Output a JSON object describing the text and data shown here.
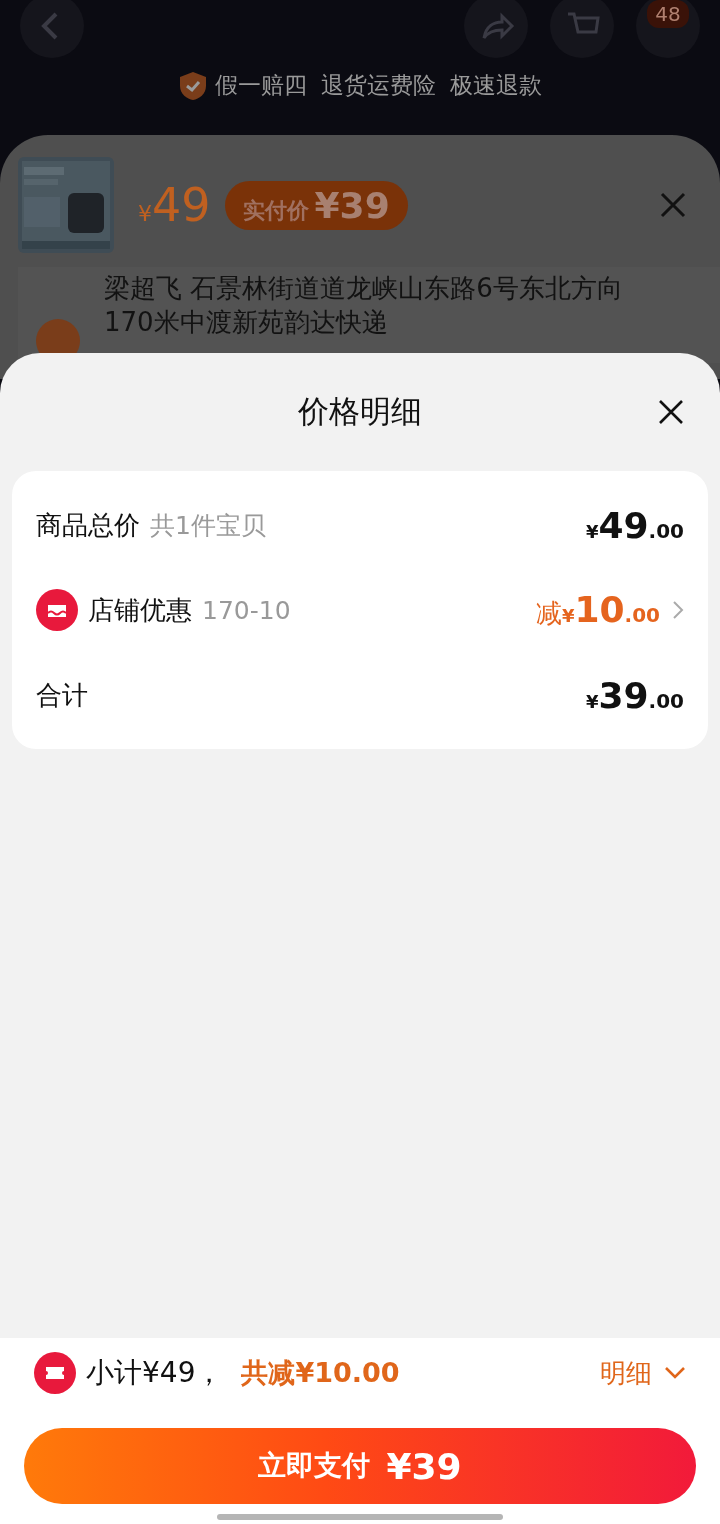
{
  "top_bar": {
    "badge": "48"
  },
  "guarantees": [
    "假一赔四",
    "退货运费险",
    "极速退款"
  ],
  "product_sheet": {
    "currency": "¥",
    "price": "49",
    "tag_label": "实付价",
    "tag_amount": "¥39",
    "address": "梁超飞  石景林街道道龙峡山东路6号东北方向170米中渡新苑韵达快递"
  },
  "price_detail": {
    "title": "价格明细",
    "rows": [
      {
        "kind": "plain",
        "label": "商品总价",
        "note": "共1件宝贝",
        "prefix": "",
        "currency": "¥",
        "integer": "49",
        "decimal": ".00"
      },
      {
        "kind": "discount",
        "label": "店铺优惠",
        "note": "170-10",
        "prefix": "减",
        "currency": "¥",
        "integer": "10",
        "decimal": ".00"
      },
      {
        "kind": "plain",
        "label": "合计",
        "note": "",
        "prefix": "",
        "currency": "¥",
        "integer": "39",
        "decimal": ".00"
      }
    ]
  },
  "footer": {
    "subtotal": "小计¥49，",
    "saved": "共减¥10.00",
    "toggle": "明细",
    "expanded": true,
    "pay_label": "立即支付",
    "pay_amount": "¥39"
  }
}
